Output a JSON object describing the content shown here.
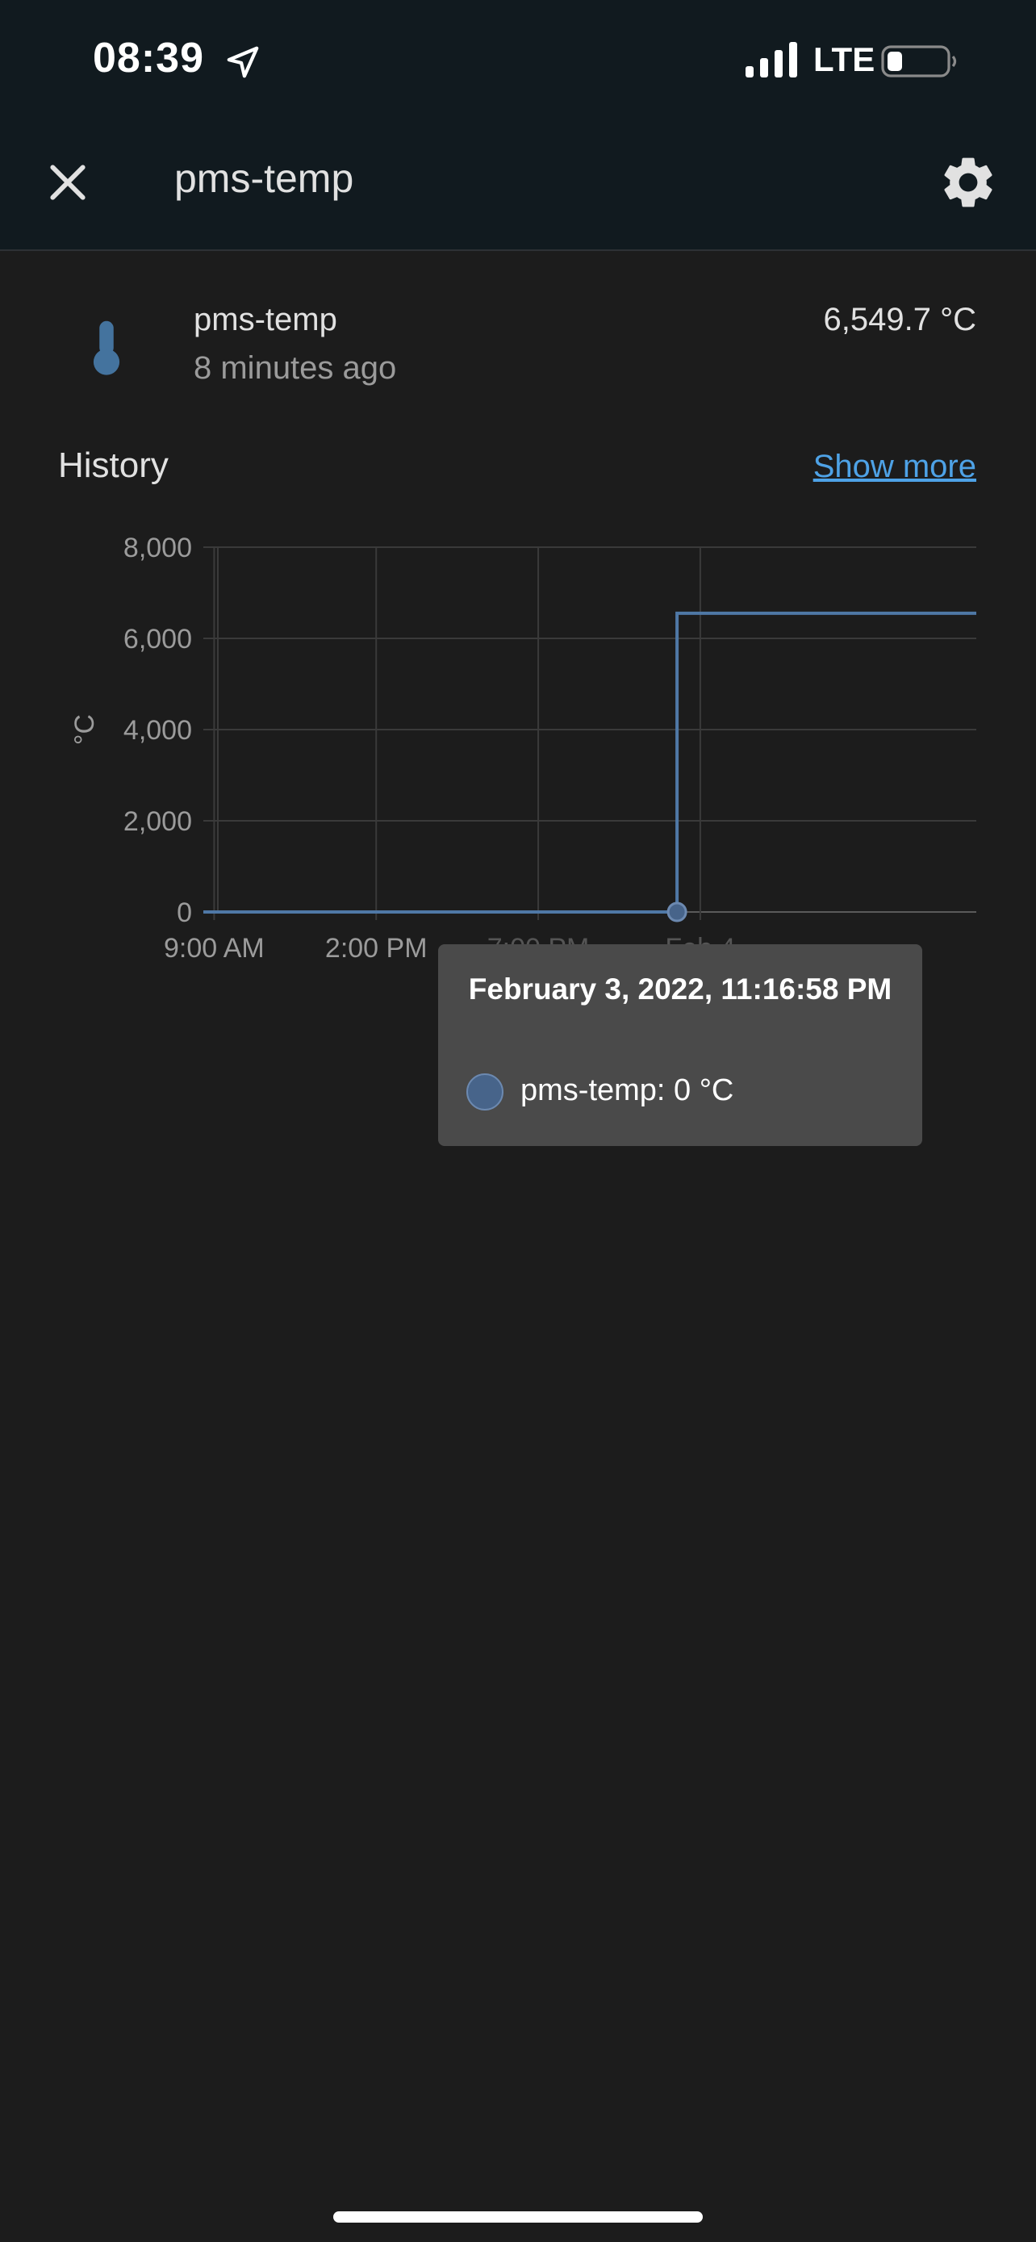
{
  "status_bar": {
    "time": "08:39",
    "network": "LTE",
    "icons": [
      "location-arrow-icon",
      "signal-bars-icon",
      "battery-icon"
    ]
  },
  "app_bar": {
    "title": "pms-temp",
    "close_icon": "close-icon",
    "settings_icon": "gear-icon"
  },
  "entity": {
    "name": "pms-temp",
    "last_changed": "8 minutes ago",
    "state": "6,549.7 °C",
    "icon": "thermometer-icon",
    "icon_color": "#44739e"
  },
  "history": {
    "title": "History",
    "show_more": "Show more"
  },
  "chart_data": {
    "type": "line",
    "step": true,
    "ylabel": "°C",
    "ylim": [
      0,
      8000
    ],
    "yticks": [
      "8,000",
      "6,000",
      "4,000",
      "2,000",
      "0"
    ],
    "xticks": [
      "9:00 AM",
      "2:00 PM",
      "7:00 PM",
      "Feb 4"
    ],
    "grid": true,
    "series": [
      {
        "name": "pms-temp",
        "color": "#4f78a6",
        "points": [
          {
            "x": "Feb 3, 2022 08:40",
            "y": 0
          },
          {
            "x": "Feb 3, 2022 23:16:58",
            "y": 0
          },
          {
            "x": "Feb 3, 2022 23:17",
            "y": 6549.7
          },
          {
            "x": "Feb 4, 2022 08:31",
            "y": 6549.7
          }
        ]
      }
    ]
  },
  "tooltip": {
    "title": "February 3, 2022, 11:16:58 PM",
    "label": "pms-temp: 0 °C",
    "marker_color": "#47648a"
  }
}
